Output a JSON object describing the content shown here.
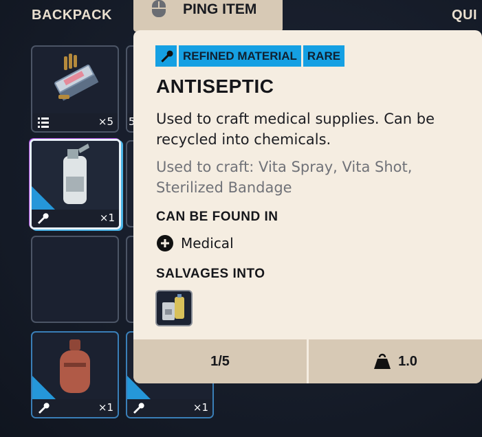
{
  "inventory": {
    "title": "BACKPACK",
    "quick_title": "QUI",
    "slots": [
      {
        "qty": "×5"
      },
      {
        "qty": "×1"
      },
      {
        "qty": "×1"
      },
      {
        "qty": "×1"
      }
    ],
    "partial_slot_label": "5"
  },
  "ping": {
    "label": "PING ITEM",
    "icon": "mouse-icon"
  },
  "tooltip": {
    "tags": [
      "REFINED MATERIAL",
      "RARE"
    ],
    "tag_icon": "wrench-icon",
    "name": "ANTISEPTIC",
    "description": "Used to craft medical supplies. Can be recycled into chemicals.",
    "craft_text": "Used to craft: Vita Spray, Vita Shot, Sterilized Bandage",
    "found_title": "CAN BE FOUND IN",
    "found_location": "Medical",
    "found_icon": "plus-circle-icon",
    "salvage_title": "SALVAGES INTO",
    "salvage_item_icon": "chemicals-icon",
    "footer": {
      "stack": "1/5",
      "weight": "1.0",
      "weight_icon": "weight-icon"
    }
  },
  "colors": {
    "accent_blue": "#15a0e3",
    "panel": "#f5ede1",
    "tab": "#d7c9b5"
  }
}
